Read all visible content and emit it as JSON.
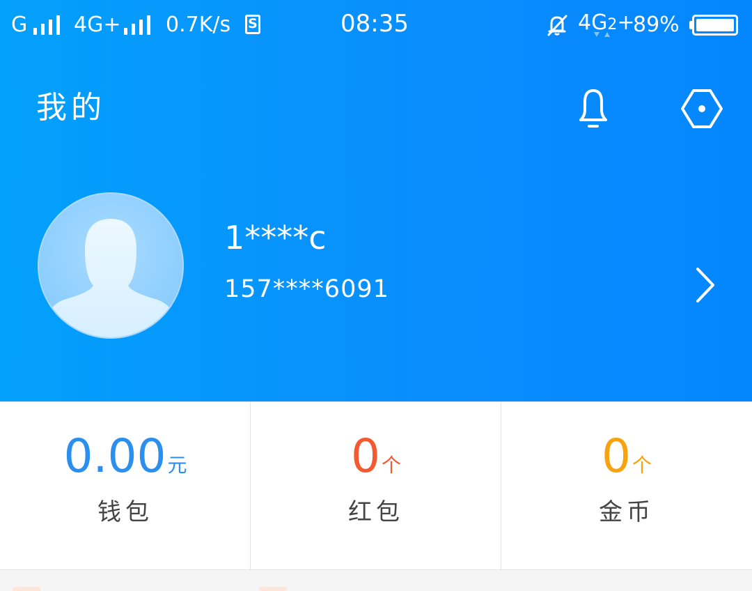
{
  "status_bar": {
    "carrier1": "G",
    "carrier2": "4G+",
    "speed": "0.7K/s",
    "sim_icon_letter": "S",
    "time": "08:35",
    "network_right": "4G",
    "network_right_sub": "2",
    "network_right_plus": "+",
    "battery": "89%"
  },
  "header": {
    "title": "我的",
    "bell_icon": "bell-icon",
    "settings_icon": "settings-gear-icon",
    "background_color": "#0a8dfd"
  },
  "profile": {
    "username": "1****c",
    "phone": "157****6091",
    "avatar_icon": "default-avatar-icon",
    "arrow_icon": "chevron-right-icon"
  },
  "stats": [
    {
      "value": "0.00",
      "unit": "元",
      "label": "钱包",
      "color": "#2b8ff0"
    },
    {
      "value": "0",
      "unit": "个",
      "label": "红包",
      "color": "#f45a32"
    },
    {
      "value": "0",
      "unit": "个",
      "label": "金币",
      "color": "#f7a20f"
    }
  ]
}
